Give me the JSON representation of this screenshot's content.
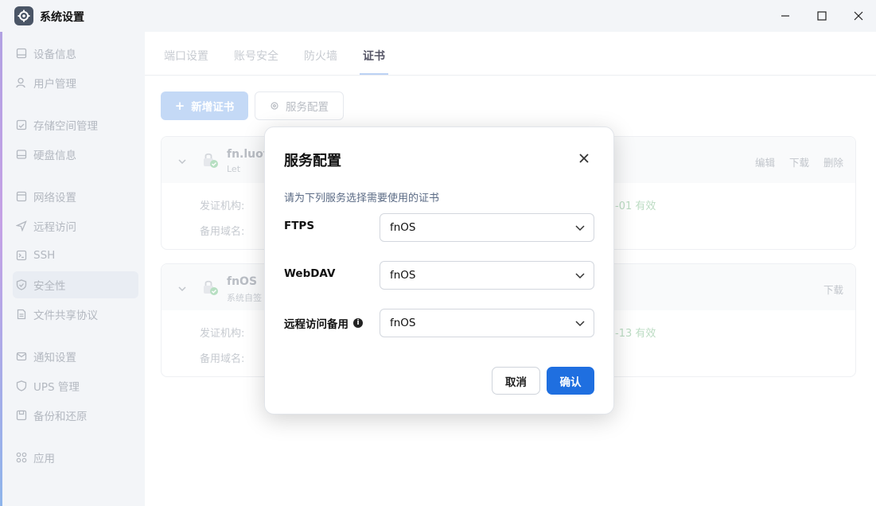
{
  "window": {
    "title": "系统设置",
    "icon": "gear-icon"
  },
  "sidebar": {
    "items": [
      {
        "label": "设备信息",
        "icon": "device-icon",
        "active": false
      },
      {
        "label": "用户管理",
        "icon": "user-icon",
        "active": false
      },
      {
        "label": "存储空间管理",
        "icon": "storage-icon",
        "active": false
      },
      {
        "label": "硬盘信息",
        "icon": "disk-icon",
        "active": false
      },
      {
        "label": "网络设置",
        "icon": "network-icon",
        "active": false
      },
      {
        "label": "远程访问",
        "icon": "send-icon",
        "active": false
      },
      {
        "label": "SSH",
        "icon": "terminal-icon",
        "active": false
      },
      {
        "label": "安全性",
        "icon": "shield-icon",
        "active": true
      },
      {
        "label": "文件共享协议",
        "icon": "file-icon",
        "active": false
      },
      {
        "label": "通知设置",
        "icon": "mail-icon",
        "active": false
      },
      {
        "label": "UPS 管理",
        "icon": "shield-outline-icon",
        "active": false
      },
      {
        "label": "备份和还原",
        "icon": "save-icon",
        "active": false
      },
      {
        "label": "应用",
        "icon": "apps-icon",
        "active": false
      }
    ]
  },
  "tabs": [
    {
      "label": "端口设置"
    },
    {
      "label": "账号安全"
    },
    {
      "label": "防火墙"
    },
    {
      "label": "证书"
    }
  ],
  "toolbar": {
    "add_label": "新增证书",
    "service_label": "服务配置"
  },
  "certs": [
    {
      "name": "fn.luoy",
      "sub": "Let",
      "issuer_label": "发证机构:",
      "domain_label": "备用域名:",
      "valid_suffix": "-01 有效",
      "actions": [
        "编辑",
        "下载",
        "删除"
      ]
    },
    {
      "name": "fnOS",
      "sub": "系统自签",
      "issuer_label": "发证机构:",
      "domain_label": "备用域名:",
      "valid_suffix": "-13 有效",
      "actions": [
        "下载"
      ]
    }
  ],
  "modal": {
    "title": "服务配置",
    "description": "请为下列服务选择需要使用的证书",
    "fields": [
      {
        "label": "FTPS",
        "value": "fnOS"
      },
      {
        "label": "WebDAV",
        "value": "fnOS"
      },
      {
        "label": "远程访问备用",
        "value": "fnOS",
        "info": "i"
      }
    ],
    "cancel_label": "取消",
    "ok_label": "确认"
  },
  "colors": {
    "accent": "#1f6fe0",
    "sidebar_bg": "#f3f5f8"
  }
}
